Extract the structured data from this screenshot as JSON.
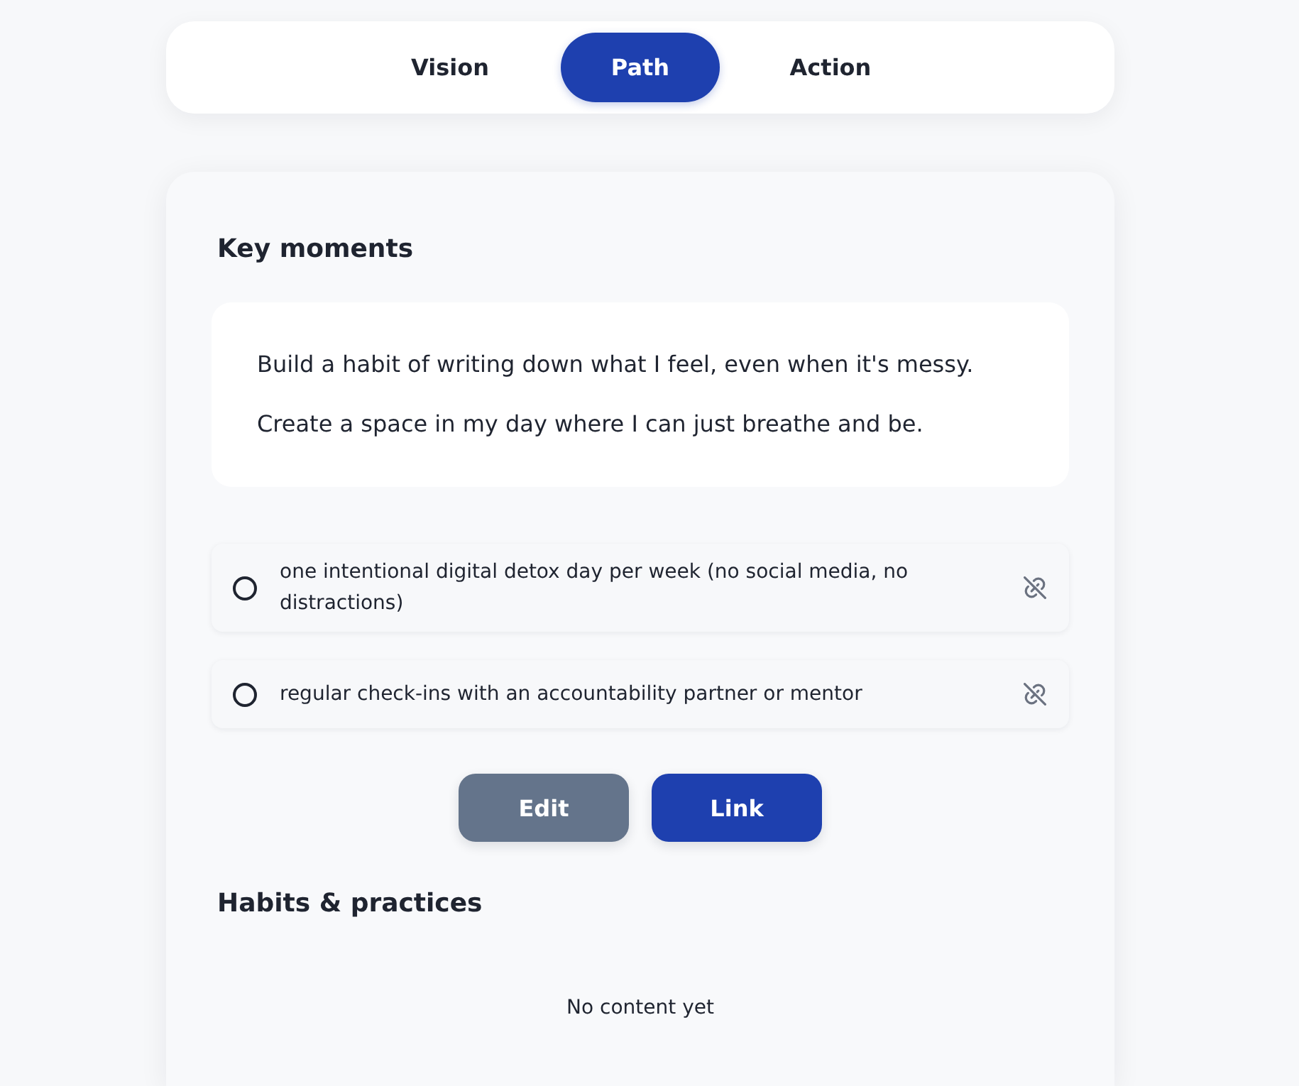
{
  "tabs": [
    {
      "label": "Vision",
      "selected": false
    },
    {
      "label": "Path",
      "selected": true
    },
    {
      "label": "Action",
      "selected": false
    }
  ],
  "key_moments": {
    "title": "Key moments",
    "statements": [
      "Build a habit of writing down what I feel, even when it's messy.",
      "Create a space in my day where I can just breathe and be."
    ],
    "items": [
      {
        "text": "one intentional digital detox day per week (no social media, no distractions)",
        "checked": false
      },
      {
        "text": "regular check-ins with an accountability partner or mentor",
        "checked": false
      }
    ],
    "buttons": [
      {
        "label": "Edit",
        "kind": "secondary"
      },
      {
        "label": "Link",
        "kind": "primary"
      }
    ]
  },
  "habits": {
    "title": "Habits & practices",
    "empty_text": "No content yet"
  }
}
